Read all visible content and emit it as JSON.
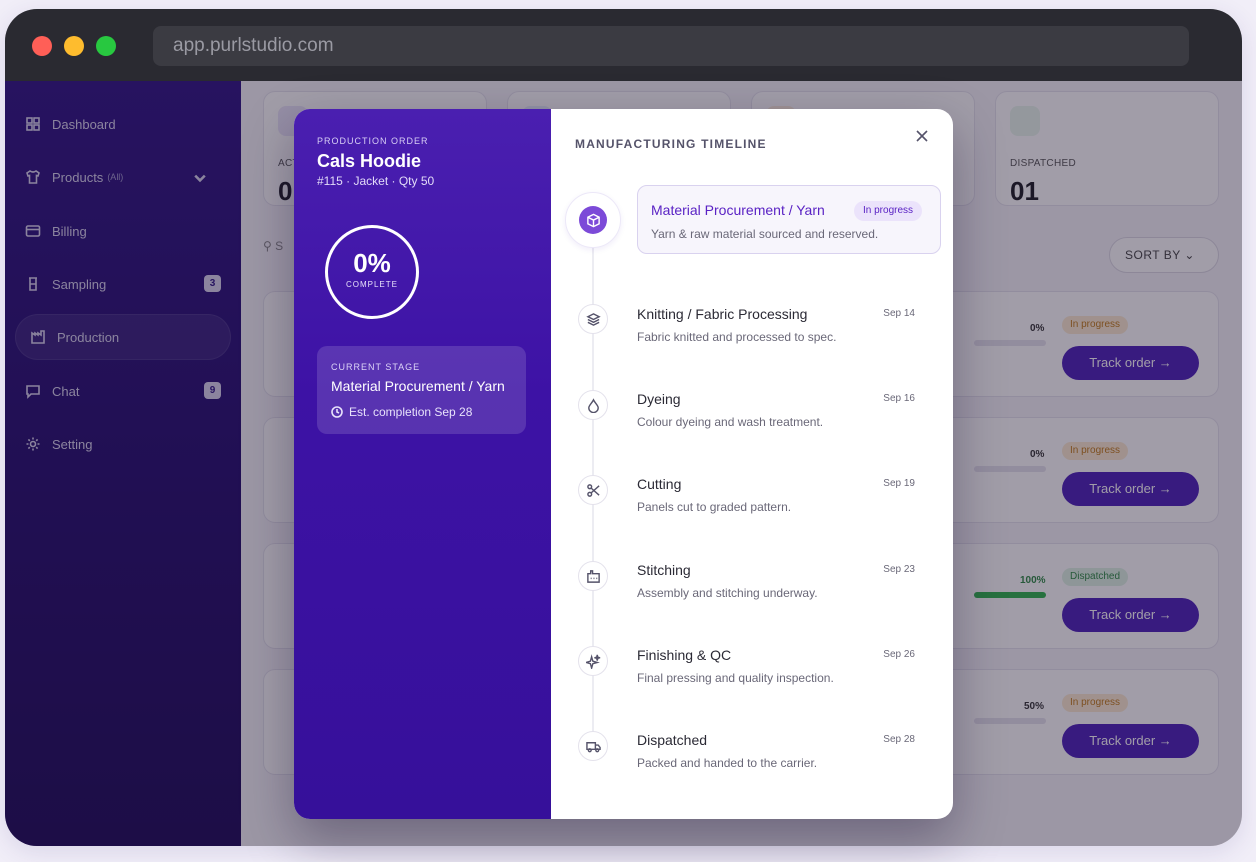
{
  "browser": {
    "url": "app.purlstudio.com"
  },
  "sidebar": {
    "items": [
      {
        "label": "Dashboard",
        "icon": "grid-icon"
      },
      {
        "label": "Products",
        "sub": "(All)",
        "icon": "shirt-icon"
      },
      {
        "label": "Billing",
        "icon": "card-icon"
      },
      {
        "label": "Sampling",
        "icon": "flask-icon",
        "badge": "3"
      },
      {
        "label": "Production",
        "icon": "factory-icon",
        "active": true
      },
      {
        "label": "Chat",
        "icon": "chat-icon",
        "badge": "9"
      },
      {
        "label": "Setting",
        "icon": "gear-icon"
      }
    ]
  },
  "dashboard": {
    "stats": [
      {
        "label": "ACT",
        "value": "0"
      },
      {
        "label": "",
        "value": ""
      },
      {
        "label": "",
        "value": ""
      },
      {
        "label": "DISPATCHED",
        "value": "01"
      }
    ],
    "search_stub": "S",
    "sort_label": "SORT BY",
    "orders": [
      {
        "pct": "0%",
        "status": "In progress",
        "track": "Track order",
        "kind": "warn"
      },
      {
        "pct": "0%",
        "status": "In progress",
        "track": "Track order",
        "kind": "warn"
      },
      {
        "pct": "100%",
        "status": "Dispatched",
        "track": "Track order",
        "kind": "ok"
      },
      {
        "pct": "50%",
        "status": "In progress",
        "track": "Track order",
        "kind": "warn"
      }
    ]
  },
  "modal": {
    "kicker": "PRODUCTION ORDER",
    "name": "Cals Hoodie",
    "meta": "#115 · Jacket · Qty 50",
    "progress": {
      "value": "0%",
      "label": "COMPLETE"
    },
    "current_stage": {
      "kicker": "CURRENT STAGE",
      "name": "Material Procurement / Yarn",
      "eta": "Est. completion Sep 28"
    },
    "timeline_title": "MANUFACTURING TIMELINE",
    "steps": [
      {
        "name": "Material Procurement / Yarn",
        "desc": "Yarn & raw material sourced and reserved.",
        "badge": "In progress",
        "icon": "box-icon"
      },
      {
        "name": "Knitting / Fabric Processing",
        "desc": "Fabric knitted and processed to spec.",
        "date": "Sep 14",
        "icon": "layers-icon"
      },
      {
        "name": "Dyeing",
        "desc": "Colour dyeing and wash treatment.",
        "date": "Sep 16",
        "icon": "droplet-icon"
      },
      {
        "name": "Cutting",
        "desc": "Panels cut to graded pattern.",
        "date": "Sep 19",
        "icon": "scissors-icon"
      },
      {
        "name": "Stitching",
        "desc": "Assembly and stitching underway.",
        "date": "Sep 23",
        "icon": "factory-icon"
      },
      {
        "name": "Finishing & QC",
        "desc": "Final pressing and quality inspection.",
        "date": "Sep 26",
        "icon": "sparkle-icon"
      },
      {
        "name": "Dispatched",
        "desc": "Packed and handed to the carrier.",
        "date": "Sep 28",
        "icon": "truck-icon"
      }
    ]
  },
  "colors": {
    "brand": "#4a1fb8",
    "sidebar": "#2d1283",
    "accent_current": "#5a22c4",
    "status_warn": "#c27a17",
    "status_ok": "#2d8a43"
  }
}
